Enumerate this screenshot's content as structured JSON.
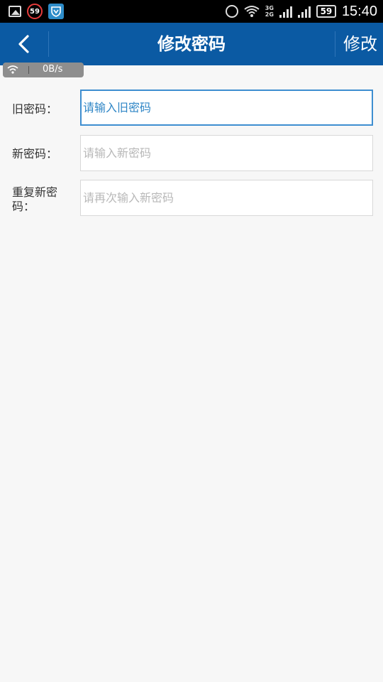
{
  "status_bar": {
    "time": "15:40",
    "battery_level": "59",
    "notification_badge": "59",
    "network_label_top": "3G",
    "network_label_bottom": "2G"
  },
  "header": {
    "title": "修改密码",
    "action_label": "修改"
  },
  "speed_indicator": {
    "value": "0B/s"
  },
  "form": {
    "old_password": {
      "label": "旧密码：",
      "placeholder": "请输入旧密码",
      "value": ""
    },
    "new_password": {
      "label": "新密码：",
      "placeholder": "请输入新密码",
      "value": ""
    },
    "repeat_password": {
      "label": "重复新密码：",
      "placeholder": "请再次输入新密码",
      "value": ""
    }
  },
  "colors": {
    "header_bg": "#0b5aa3",
    "page_bg": "#f7f7f7",
    "focus_border": "#3e8ed0"
  }
}
